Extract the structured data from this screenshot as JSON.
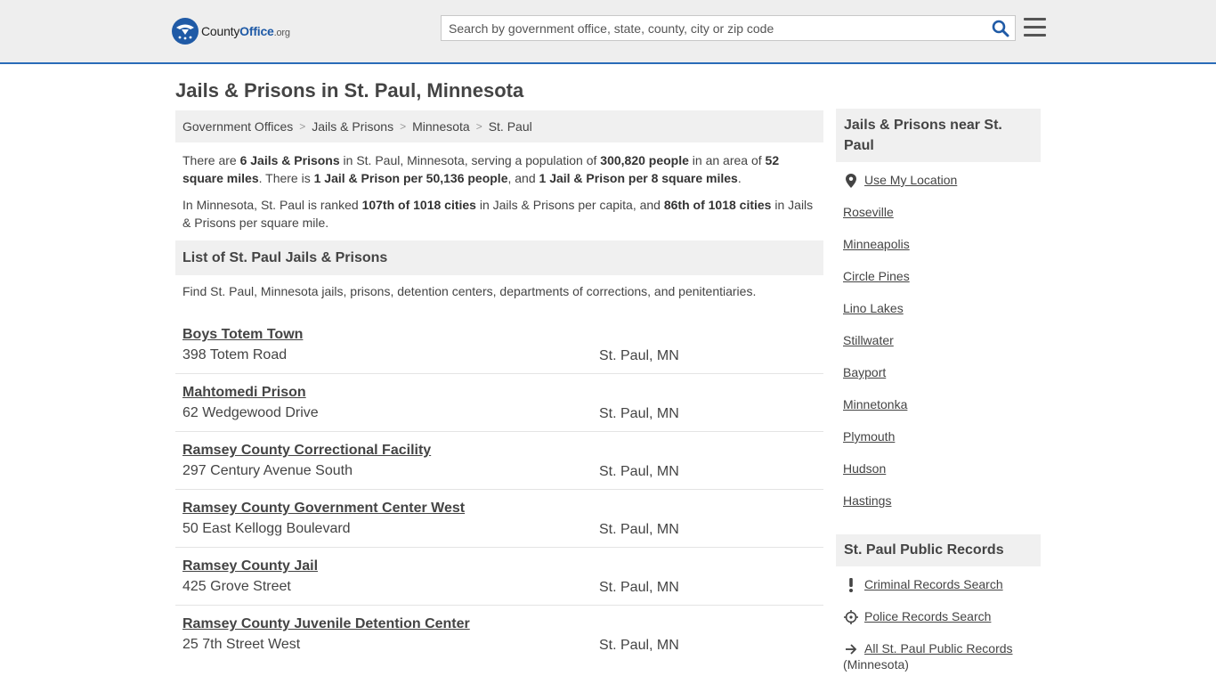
{
  "header": {
    "logo": {
      "county": "County",
      "office": "Office",
      "org": ".org"
    },
    "search_placeholder": "Search by government office, state, county, city or zip code"
  },
  "page_title": "Jails & Prisons in St. Paul, Minnesota",
  "breadcrumb": [
    "Government Offices",
    "Jails & Prisons",
    "Minnesota",
    "St. Paul"
  ],
  "intro": {
    "p1": [
      "There are ",
      "6 Jails & Prisons",
      " in St. Paul, Minnesota, serving a population of ",
      "300,820 people",
      " in an area of ",
      "52 square miles",
      ". There is ",
      "1 Jail & Prison per 50,136 people",
      ", and ",
      "1 Jail & Prison per 8 square miles",
      "."
    ],
    "p2": [
      "In Minnesota, St. Paul is ranked ",
      "107th of 1018 cities",
      " in Jails & Prisons per capita, and ",
      "86th of 1018 cities",
      " in Jails & Prisons per square mile."
    ]
  },
  "list": {
    "heading": "List of St. Paul Jails & Prisons",
    "description": "Find St. Paul, Minnesota jails, prisons, detention centers, departments of corrections, and penitentiaries.",
    "entries": [
      {
        "name": "Boys Totem Town",
        "address": "398 Totem Road",
        "city": "St. Paul, MN"
      },
      {
        "name": "Mahtomedi Prison",
        "address": "62 Wedgewood Drive",
        "city": "St. Paul, MN"
      },
      {
        "name": "Ramsey County Correctional Facility",
        "address": "297 Century Avenue South",
        "city": "St. Paul, MN"
      },
      {
        "name": "Ramsey County Government Center West",
        "address": "50 East Kellogg Boulevard",
        "city": "St. Paul, MN"
      },
      {
        "name": "Ramsey County Jail",
        "address": "425 Grove Street",
        "city": "St. Paul, MN"
      },
      {
        "name": "Ramsey County Juvenile Detention Center",
        "address": "25 7th Street West",
        "city": "St. Paul, MN"
      }
    ]
  },
  "sidebar": {
    "near_heading": "Jails & Prisons near St. Paul",
    "use_location": "Use My Location",
    "nearby": [
      "Roseville",
      "Minneapolis",
      "Circle Pines",
      "Lino Lakes",
      "Stillwater",
      "Bayport",
      "Minnetonka",
      "Plymouth",
      "Hudson",
      "Hastings"
    ],
    "records_heading": "St. Paul Public Records",
    "records": [
      {
        "label": "Criminal Records Search",
        "icon": "exclamation-icon"
      },
      {
        "label": "Police Records Search",
        "icon": "crosshair-icon"
      },
      {
        "label": "All St. Paul Public Records",
        "sub": "(Minnesota)",
        "icon": "arrow-right-icon"
      }
    ]
  },
  "colors": {
    "accent": "#2a6cb8",
    "logo_blue": "#1f5aa6",
    "panel": "#f0f0f0",
    "topbar": "#eeeeee"
  }
}
